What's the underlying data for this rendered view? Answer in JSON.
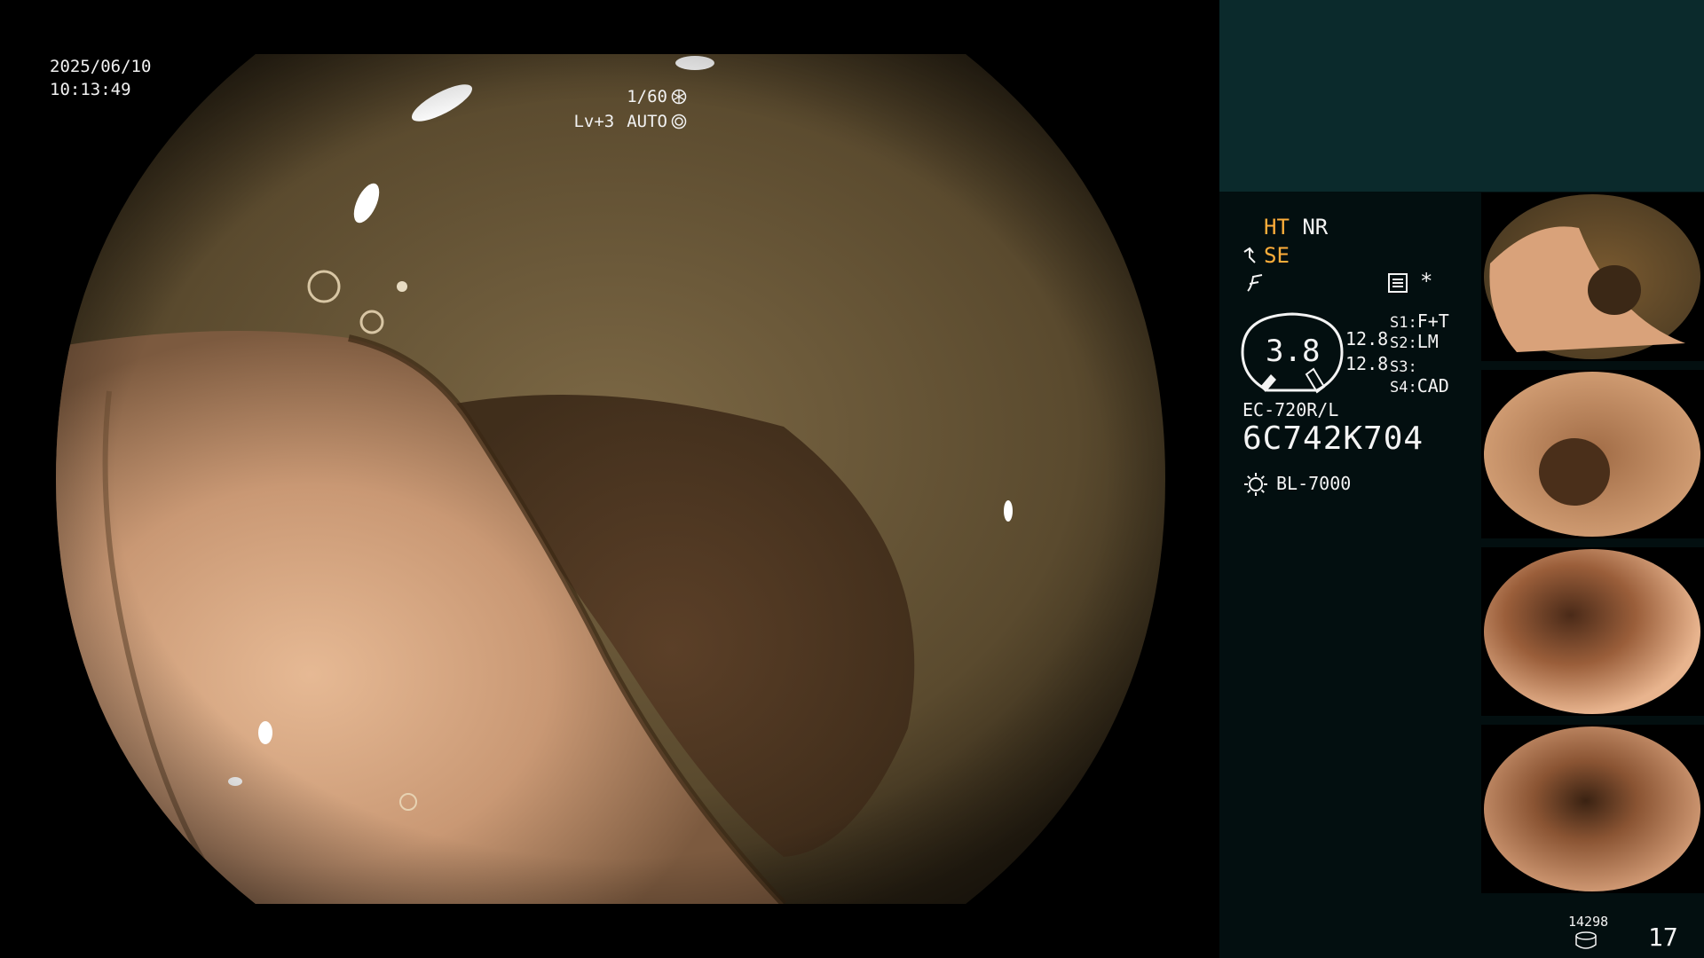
{
  "overlay": {
    "date": "2025/06/10",
    "time": "10:13:49",
    "shutter": "1/60",
    "shutter_icon": "shutter-icon",
    "level": "Lv+3",
    "iris_mode": "AUTO",
    "iris_icon": "iris-icon"
  },
  "panel": {
    "ht": "HT",
    "nr": "NR",
    "se": "SE",
    "se_icon": "structure-enhance-icon",
    "filter_icon": "filter-icon",
    "menu_icon": "menu-icon",
    "asterisk": "*",
    "gauge_value": "3.8",
    "gauge_readout_1": "12.8",
    "gauge_readout_2": "12.8",
    "s1_label": "S1:",
    "s1_value": "F+T",
    "s2_label": "S2:",
    "s2_value": "LM",
    "s3_label": "S3:",
    "s3_value": "",
    "s4_label": "S4:",
    "s4_value": "CAD",
    "scope_model": "EC-720R/L",
    "scope_serial": "6C742K704",
    "light_icon": "light-source-icon",
    "light_source": "BL-7000",
    "record_count": "14298",
    "record_icon": "storage-icon",
    "page_number": "17"
  },
  "colors": {
    "panel_bg": "#030f10",
    "panel_band": "#0b2a2c",
    "accent_orange": "#ffae3a",
    "osd_text": "#f2f2f2"
  }
}
